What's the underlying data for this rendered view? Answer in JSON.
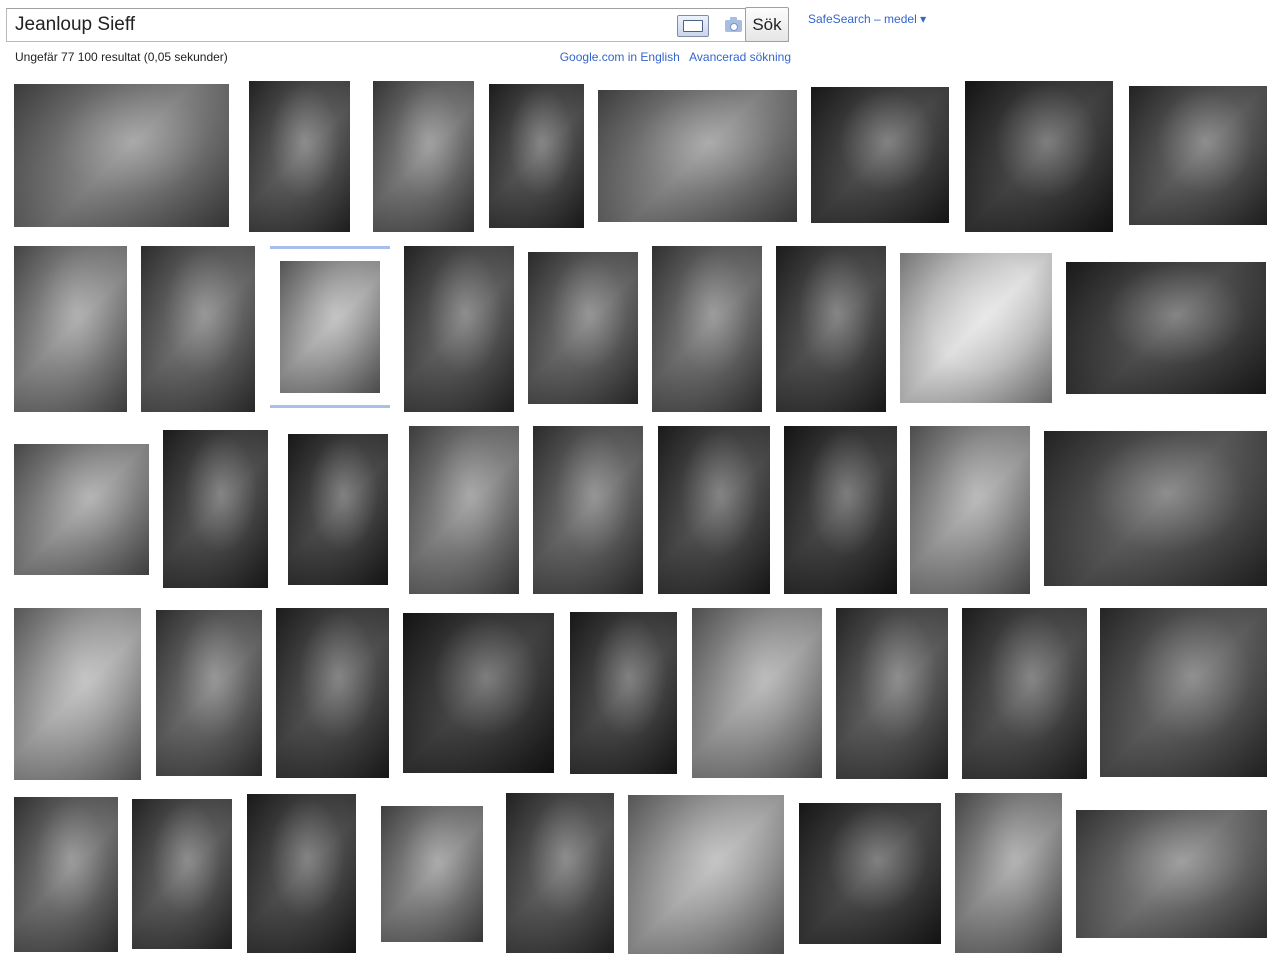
{
  "search": {
    "query": "Jeanloup Sieff",
    "keyboard_icon": "keyboard-icon",
    "camera_icon": "camera-icon",
    "submit_label": "Sök"
  },
  "safesearch_label": "SafeSearch – medel ▾",
  "result_stats": "Ungefär 77 100 resultat (0,05 sekunder)",
  "links": {
    "english": "Google.com in English",
    "advanced": "Avancerad sökning"
  },
  "colors": {
    "link": "#3366cc",
    "selected_border": "#a8bfe9"
  },
  "thumbnails": [
    {
      "tone": "#6a6a6a"
    },
    {
      "tone": "#3a3a3a"
    },
    {
      "tone": "#5e5e5e"
    },
    {
      "tone": "#2f2f2f"
    },
    {
      "tone": "#6e6e6e"
    },
    {
      "tone": "#262626"
    },
    {
      "tone": "#1f1f1f"
    },
    {
      "tone": "#3b3b3b"
    },
    {
      "tone": "#7a7a7a"
    },
    {
      "tone": "#4e4e4e"
    },
    {
      "tone": "#9a9a9a"
    },
    {
      "tone": "#3c3c3c"
    },
    {
      "tone": "#4a4a4a"
    },
    {
      "tone": "#555555"
    },
    {
      "tone": "#2e2e2e"
    },
    {
      "tone": "#d8d8d8"
    },
    {
      "tone": "#2a2a2a"
    },
    {
      "tone": "#7f7f7f"
    },
    {
      "tone": "#2c2c2c"
    },
    {
      "tone": "#262626"
    },
    {
      "tone": "#6b6b6b"
    },
    {
      "tone": "#4a4a4a"
    },
    {
      "tone": "#2b2b2b"
    },
    {
      "tone": "#1f1f1f"
    },
    {
      "tone": "#8a8a8a"
    },
    {
      "tone": "#3a3a3a"
    },
    {
      "tone": "#9c9c9c"
    },
    {
      "tone": "#4d4d4d"
    },
    {
      "tone": "#2d2d2d"
    },
    {
      "tone": "#1e1e1e"
    },
    {
      "tone": "#262626"
    },
    {
      "tone": "#8d8d8d"
    },
    {
      "tone": "#3d3d3d"
    },
    {
      "tone": "#2e2e2e"
    },
    {
      "tone": "#3f3f3f"
    },
    {
      "tone": "#555555"
    },
    {
      "tone": "#3b3b3b"
    },
    {
      "tone": "#2a2a2a"
    },
    {
      "tone": "#6f6f6f"
    },
    {
      "tone": "#3a3a3a"
    },
    {
      "tone": "#9b9b9b"
    },
    {
      "tone": "#232323"
    },
    {
      "tone": "#7e7e7e"
    },
    {
      "tone": "#585858"
    },
    {
      "tone": "#2c2c2c"
    },
    {
      "tone": "#6d6d6d"
    }
  ]
}
